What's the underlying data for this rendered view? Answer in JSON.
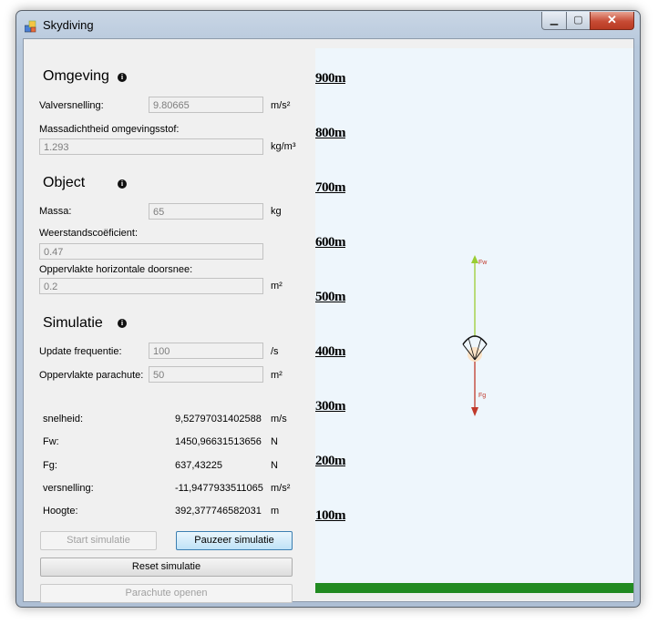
{
  "window": {
    "title": "Skydiving",
    "close_glyph": "✕",
    "minimize_glyph": "▁",
    "maximize_glyph": "▢"
  },
  "omgeving": {
    "title": "Omgeving",
    "valversnelling": {
      "label": "Valversnelling:",
      "value": "9.80665",
      "unit": "m/s²"
    },
    "massadichtheid": {
      "label": "Massadichtheid omgevingsstof:",
      "value": "1.293",
      "unit": "kg/m³"
    }
  },
  "object": {
    "title": "Object",
    "massa": {
      "label": "Massa:",
      "value": "65",
      "unit": "kg"
    },
    "weerstand": {
      "label": "Weerstandscoëficient:",
      "value": "0.47"
    },
    "oppervlakte": {
      "label": "Oppervlakte horizontale doorsnee:",
      "value": "0.2",
      "unit": "m²"
    }
  },
  "simulatie": {
    "title": "Simulatie",
    "update": {
      "label": "Update frequentie:",
      "value": "100",
      "unit": "/s"
    },
    "parachute": {
      "label": "Oppervlakte parachute:",
      "value": "50",
      "unit": "m²"
    }
  },
  "stats": [
    {
      "label": "snelheid:",
      "value": "9,52797031402588",
      "unit": "m/s"
    },
    {
      "label": "Fw:",
      "value": "1450,96631513656",
      "unit": "N"
    },
    {
      "label": "Fg:",
      "value": "637,43225",
      "unit": "N"
    },
    {
      "label": "versnelling:",
      "value": "-11,9477933511065",
      "unit": "m/s²"
    },
    {
      "label": "Hoogte:",
      "value": "392,377746582031",
      "unit": "m"
    }
  ],
  "buttons": {
    "start": "Start simulatie",
    "pause": "Pauzeer simulatie",
    "reset": "Reset simulatie",
    "parachute": "Parachute openen"
  },
  "altitude_marks": [
    "900m",
    "800m",
    "700m",
    "600m",
    "500m",
    "400m",
    "300m",
    "200m",
    "100m"
  ],
  "vectors": {
    "up_label": "Fw",
    "down_label": "Fg",
    "up_color": "#9acd32",
    "down_color": "#c0392b"
  },
  "colors": {
    "sky": "#eef6fc",
    "ground": "#228b22"
  }
}
